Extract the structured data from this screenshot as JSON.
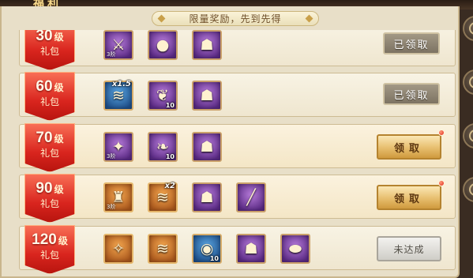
{
  "header": {
    "title": "福利"
  },
  "banner": {
    "text": "限量奖励，先到先得"
  },
  "side_buttons": [
    "side-button-1",
    "side-button-2",
    "side-button-3",
    "side-button-4"
  ],
  "rows": [
    {
      "level": "30",
      "unit": "级",
      "sub": "礼包",
      "items": [
        {
          "icon": "weapon-icon",
          "quality": "purple",
          "count": "",
          "tag": "3阶",
          "mult": ""
        },
        {
          "icon": "berries-icon",
          "quality": "purple",
          "count": "",
          "tag": "",
          "mult": ""
        },
        {
          "icon": "gold-sack-icon",
          "quality": "purple",
          "count": "",
          "tag": "",
          "mult": ""
        }
      ],
      "button": {
        "state": "claimed",
        "label": "已领取"
      }
    },
    {
      "level": "60",
      "unit": "级",
      "sub": "礼包",
      "items": [
        {
          "icon": "scroll-icon",
          "quality": "blue",
          "count": "",
          "tag": "",
          "mult": "x1.5"
        },
        {
          "icon": "carrot-icon",
          "quality": "purple",
          "count": "10",
          "tag": "",
          "mult": ""
        },
        {
          "icon": "gold-sack-icon",
          "quality": "purple",
          "count": "",
          "tag": "",
          "mult": ""
        }
      ],
      "button": {
        "state": "claimed",
        "label": "已领取"
      }
    },
    {
      "level": "70",
      "unit": "级",
      "sub": "礼包",
      "items": [
        {
          "icon": "sword-icon",
          "quality": "purple",
          "count": "",
          "tag": "3阶",
          "mult": ""
        },
        {
          "icon": "leaf-icon",
          "quality": "purple",
          "count": "10",
          "tag": "",
          "mult": ""
        },
        {
          "icon": "gold-sack-icon",
          "quality": "purple",
          "count": "",
          "tag": "",
          "mult": ""
        }
      ],
      "button": {
        "state": "claim",
        "label": "领取",
        "dot": true
      }
    },
    {
      "level": "90",
      "unit": "级",
      "sub": "礼包",
      "items": [
        {
          "icon": "armor-icon",
          "quality": "orange",
          "count": "",
          "tag": "3阶",
          "mult": ""
        },
        {
          "icon": "scroll-icon",
          "quality": "orange",
          "count": "",
          "tag": "",
          "mult": "x2"
        },
        {
          "icon": "gold-sack-icon",
          "quality": "purple",
          "count": "",
          "tag": "",
          "mult": ""
        },
        {
          "icon": "brush-icon",
          "quality": "purple",
          "count": "",
          "tag": "",
          "mult": ""
        }
      ],
      "button": {
        "state": "claim",
        "label": "领取",
        "dot": true
      }
    },
    {
      "level": "120",
      "unit": "级",
      "sub": "礼包",
      "items": [
        {
          "icon": "feather-icon",
          "quality": "orange",
          "count": "",
          "tag": "",
          "mult": ""
        },
        {
          "icon": "scroll-icon",
          "quality": "orange",
          "count": "",
          "tag": "",
          "mult": ""
        },
        {
          "icon": "orb-icon",
          "quality": "blue",
          "count": "10",
          "tag": "",
          "mult": ""
        },
        {
          "icon": "gold-sack-icon",
          "quality": "purple",
          "count": "",
          "tag": "",
          "mult": ""
        },
        {
          "icon": "gold-ingot-icon",
          "quality": "purple",
          "count": "",
          "tag": "",
          "mult": ""
        }
      ],
      "button": {
        "state": "locked",
        "label": "未达成"
      }
    }
  ]
}
